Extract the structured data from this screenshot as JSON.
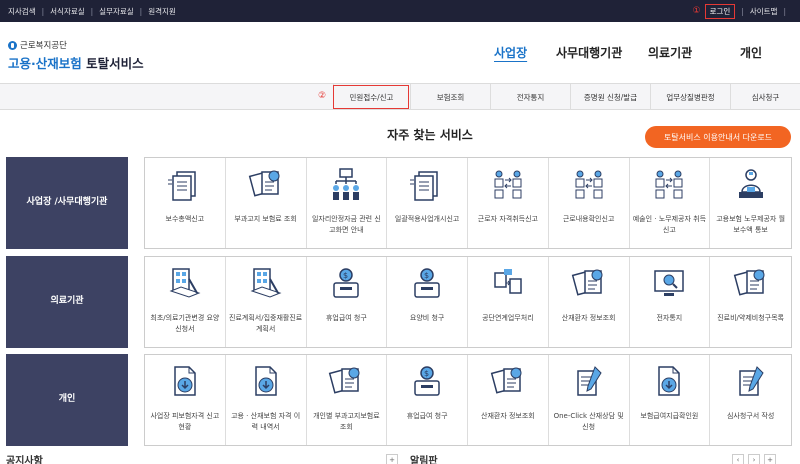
{
  "topbar": {
    "links": [
      "지사검색",
      "서식자료실",
      "실무자료실",
      "원격지원"
    ],
    "marker1": "①",
    "login": "로그인",
    "sitemap": "사이트맵"
  },
  "header": {
    "org_name": "근로복지공단",
    "site_name_blue": "고용·산재보험",
    "site_name_dark": "토탈서비스",
    "nav": [
      "사업장",
      "사무대행기관",
      "의료기관",
      "개인"
    ]
  },
  "subnav": {
    "marker2": "②",
    "items": [
      "민원접수/신고",
      "보험조회",
      "전자통지",
      "증명원 신청/발급",
      "업무상질병판정",
      "심사청구"
    ]
  },
  "section": {
    "title": "자주 찾는 서비스",
    "download_button": "토탈서비스 이용안내서 다운로드"
  },
  "rows": [
    {
      "category": [
        "사업장 /",
        "사무대행기관"
      ],
      "services": [
        {
          "icon": "document-list-icon",
          "label": "보수총액신고"
        },
        {
          "icon": "document-search-icon",
          "label": "부과고지 보험료 조회"
        },
        {
          "icon": "org-chart-icon",
          "label": "일자리안정자금 관련 신고화면 안내"
        },
        {
          "icon": "document-list-icon",
          "label": "일괄적용사업개시신고"
        },
        {
          "icon": "people-exchange-icon",
          "label": "근로자 자격취득신고"
        },
        {
          "icon": "people-exchange-icon",
          "label": "근로내용확인신고"
        },
        {
          "icon": "people-exchange-icon",
          "label": "예술인 · 노무제공자 취득신고"
        },
        {
          "icon": "worker-laptop-icon",
          "label": "고용보험 노무제공자 월보수액 통보"
        }
      ]
    },
    {
      "category": [
        "의료기관"
      ],
      "services": [
        {
          "icon": "building-pen-icon",
          "label": "최초/의료기관변경 요양신청서"
        },
        {
          "icon": "building-pen-icon",
          "label": "진료계획서/집중재활진료계획서"
        },
        {
          "icon": "money-box-icon",
          "label": "휴업급여 청구"
        },
        {
          "icon": "money-box-icon",
          "label": "요양비 청구"
        },
        {
          "icon": "document-transfer-icon",
          "label": "공단연계업무처리"
        },
        {
          "icon": "document-search-icon",
          "label": "산재환자 정보조회"
        },
        {
          "icon": "monitor-search-icon",
          "label": "전자통지"
        },
        {
          "icon": "document-search-icon",
          "label": "진료비/약제비청구목록"
        }
      ]
    },
    {
      "category": [
        "개인"
      ],
      "services": [
        {
          "icon": "file-download-icon",
          "label": "사업장 피보험자격 신고현황"
        },
        {
          "icon": "file-download-icon",
          "label": "고용 · 산재보험 자격 이력 내역서"
        },
        {
          "icon": "document-search-icon",
          "label": "개인별 부과고지보험료 조회"
        },
        {
          "icon": "money-box-icon",
          "label": "휴업급여 청구"
        },
        {
          "icon": "document-search-icon",
          "label": "산재환자 정보조회"
        },
        {
          "icon": "document-pen-icon",
          "label": "One-Click 산재상담 및 신청"
        },
        {
          "icon": "file-download-icon",
          "label": "보험급여지급확인원"
        },
        {
          "icon": "document-pen-icon",
          "label": "심사청구서 작성"
        }
      ]
    }
  ],
  "bottom": {
    "left_title": "공지사항",
    "right_title": "알림판"
  },
  "colors": {
    "topbar": "#1f2237",
    "brand_blue": "#1a73c8",
    "category_bg": "#3d4263",
    "accent_orange": "#f26522",
    "highlight_red": "#e53935"
  }
}
